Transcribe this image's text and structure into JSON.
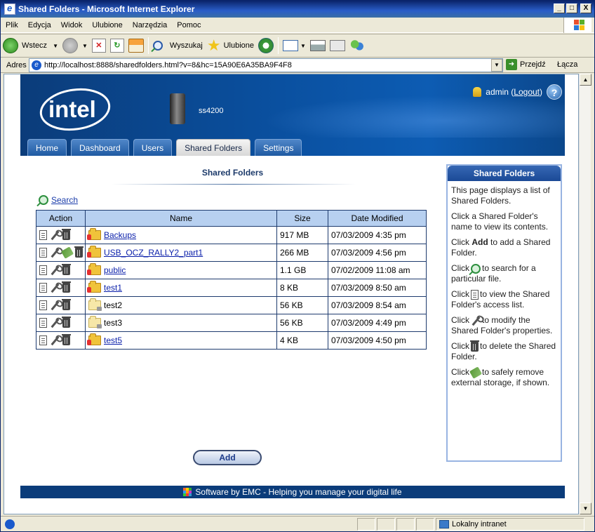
{
  "window": {
    "title": "Shared Folders - Microsoft Internet Explorer",
    "min": "_",
    "max": "□",
    "close": "X"
  },
  "menu": {
    "items": [
      "Plik",
      "Edycja",
      "Widok",
      "Ulubione",
      "Narzędzia",
      "Pomoc"
    ]
  },
  "toolbar": {
    "back": "Wstecz",
    "search": "Wyszukaj",
    "favorites": "Ulubione"
  },
  "address": {
    "label": "Adres",
    "url": "http://localhost:8888/sharedfolders.html?v=8&hc=15A90E6A35BA9F4F8",
    "go": "Przejdź",
    "links": "Łącza"
  },
  "status": {
    "zone": "Lokalny intranet"
  },
  "header": {
    "brand": "intel",
    "device_name": "ss4200",
    "user": "admin",
    "logout": "Logout",
    "help": "?"
  },
  "tabs": [
    "Home",
    "Dashboard",
    "Users",
    "Shared Folders",
    "Settings"
  ],
  "active_tab": "Shared Folders",
  "main": {
    "title": "Shared Folders",
    "search_label": "Search",
    "columns": [
      "Action",
      "Name",
      "Size",
      "Date Modified"
    ],
    "rows": [
      {
        "name": "Backups",
        "size": "917 MB",
        "date": "07/03/2009 4:35 pm",
        "link": true,
        "eject": false,
        "shared": true
      },
      {
        "name": "USB_OCZ_RALLY2_part1",
        "size": "266 MB",
        "date": "07/03/2009 4:56 pm",
        "link": true,
        "eject": true,
        "shared": true
      },
      {
        "name": "public",
        "size": "1.1 GB",
        "date": "07/02/2009 11:08 am",
        "link": true,
        "eject": false,
        "shared": true
      },
      {
        "name": "test1",
        "size": "8 KB",
        "date": "07/03/2009 8:50 am",
        "link": true,
        "eject": false,
        "shared": true
      },
      {
        "name": "test2",
        "size": "56 KB",
        "date": "07/03/2009 8:54 am",
        "link": false,
        "eject": false,
        "shared": false
      },
      {
        "name": "test3",
        "size": "56 KB",
        "date": "07/03/2009 4:49 pm",
        "link": false,
        "eject": false,
        "shared": false
      },
      {
        "name": "test5",
        "size": "4 KB",
        "date": "07/03/2009 4:50 pm",
        "link": true,
        "eject": false,
        "shared": true
      }
    ],
    "add_label": "Add"
  },
  "sidebar": {
    "title": "Shared Folders",
    "p1": "This page displays a list of Shared Folders.",
    "p2": "Click a Shared Folder's name to view its contents.",
    "p3_pre": "Click",
    "p3_bold": "Add",
    "p3_post": "to add a Shared Folder.",
    "p4_pre": "Click",
    "p4_post": "to search for a particular file.",
    "p5_pre": "Click",
    "p5_post": "to view the Shared Folder's access list.",
    "p6_pre": "Click",
    "p6_post": "to modify the Shared Folder's properties.",
    "p7_pre": "Click",
    "p7_post": "to delete the Shared Folder.",
    "p8_pre": "Click",
    "p8_post": "to safely remove external storage, if shown."
  },
  "footer": {
    "text": "Software by EMC - Helping you manage your digital life"
  }
}
